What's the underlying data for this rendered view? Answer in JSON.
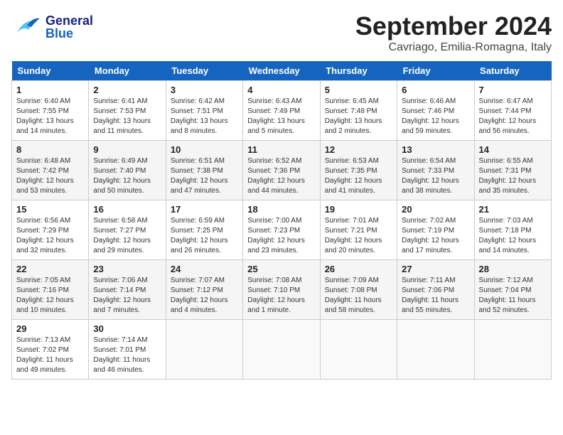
{
  "header": {
    "logo_general": "General",
    "logo_blue": "Blue",
    "month": "September 2024",
    "location": "Cavriago, Emilia-Romagna, Italy"
  },
  "weekdays": [
    "Sunday",
    "Monday",
    "Tuesday",
    "Wednesday",
    "Thursday",
    "Friday",
    "Saturday"
  ],
  "weeks": [
    [
      {
        "day": "1",
        "info": "Sunrise: 6:40 AM\nSunset: 7:55 PM\nDaylight: 13 hours\nand 14 minutes."
      },
      {
        "day": "2",
        "info": "Sunrise: 6:41 AM\nSunset: 7:53 PM\nDaylight: 13 hours\nand 11 minutes."
      },
      {
        "day": "3",
        "info": "Sunrise: 6:42 AM\nSunset: 7:51 PM\nDaylight: 13 hours\nand 8 minutes."
      },
      {
        "day": "4",
        "info": "Sunrise: 6:43 AM\nSunset: 7:49 PM\nDaylight: 13 hours\nand 5 minutes."
      },
      {
        "day": "5",
        "info": "Sunrise: 6:45 AM\nSunset: 7:48 PM\nDaylight: 13 hours\nand 2 minutes."
      },
      {
        "day": "6",
        "info": "Sunrise: 6:46 AM\nSunset: 7:46 PM\nDaylight: 12 hours\nand 59 minutes."
      },
      {
        "day": "7",
        "info": "Sunrise: 6:47 AM\nSunset: 7:44 PM\nDaylight: 12 hours\nand 56 minutes."
      }
    ],
    [
      {
        "day": "8",
        "info": "Sunrise: 6:48 AM\nSunset: 7:42 PM\nDaylight: 12 hours\nand 53 minutes."
      },
      {
        "day": "9",
        "info": "Sunrise: 6:49 AM\nSunset: 7:40 PM\nDaylight: 12 hours\nand 50 minutes."
      },
      {
        "day": "10",
        "info": "Sunrise: 6:51 AM\nSunset: 7:38 PM\nDaylight: 12 hours\nand 47 minutes."
      },
      {
        "day": "11",
        "info": "Sunrise: 6:52 AM\nSunset: 7:36 PM\nDaylight: 12 hours\nand 44 minutes."
      },
      {
        "day": "12",
        "info": "Sunrise: 6:53 AM\nSunset: 7:35 PM\nDaylight: 12 hours\nand 41 minutes."
      },
      {
        "day": "13",
        "info": "Sunrise: 6:54 AM\nSunset: 7:33 PM\nDaylight: 12 hours\nand 38 minutes."
      },
      {
        "day": "14",
        "info": "Sunrise: 6:55 AM\nSunset: 7:31 PM\nDaylight: 12 hours\nand 35 minutes."
      }
    ],
    [
      {
        "day": "15",
        "info": "Sunrise: 6:56 AM\nSunset: 7:29 PM\nDaylight: 12 hours\nand 32 minutes."
      },
      {
        "day": "16",
        "info": "Sunrise: 6:58 AM\nSunset: 7:27 PM\nDaylight: 12 hours\nand 29 minutes."
      },
      {
        "day": "17",
        "info": "Sunrise: 6:59 AM\nSunset: 7:25 PM\nDaylight: 12 hours\nand 26 minutes."
      },
      {
        "day": "18",
        "info": "Sunrise: 7:00 AM\nSunset: 7:23 PM\nDaylight: 12 hours\nand 23 minutes."
      },
      {
        "day": "19",
        "info": "Sunrise: 7:01 AM\nSunset: 7:21 PM\nDaylight: 12 hours\nand 20 minutes."
      },
      {
        "day": "20",
        "info": "Sunrise: 7:02 AM\nSunset: 7:19 PM\nDaylight: 12 hours\nand 17 minutes."
      },
      {
        "day": "21",
        "info": "Sunrise: 7:03 AM\nSunset: 7:18 PM\nDaylight: 12 hours\nand 14 minutes."
      }
    ],
    [
      {
        "day": "22",
        "info": "Sunrise: 7:05 AM\nSunset: 7:16 PM\nDaylight: 12 hours\nand 10 minutes."
      },
      {
        "day": "23",
        "info": "Sunrise: 7:06 AM\nSunset: 7:14 PM\nDaylight: 12 hours\nand 7 minutes."
      },
      {
        "day": "24",
        "info": "Sunrise: 7:07 AM\nSunset: 7:12 PM\nDaylight: 12 hours\nand 4 minutes."
      },
      {
        "day": "25",
        "info": "Sunrise: 7:08 AM\nSunset: 7:10 PM\nDaylight: 12 hours\nand 1 minute."
      },
      {
        "day": "26",
        "info": "Sunrise: 7:09 AM\nSunset: 7:08 PM\nDaylight: 11 hours\nand 58 minutes."
      },
      {
        "day": "27",
        "info": "Sunrise: 7:11 AM\nSunset: 7:06 PM\nDaylight: 11 hours\nand 55 minutes."
      },
      {
        "day": "28",
        "info": "Sunrise: 7:12 AM\nSunset: 7:04 PM\nDaylight: 11 hours\nand 52 minutes."
      }
    ],
    [
      {
        "day": "29",
        "info": "Sunrise: 7:13 AM\nSunset: 7:02 PM\nDaylight: 11 hours\nand 49 minutes."
      },
      {
        "day": "30",
        "info": "Sunrise: 7:14 AM\nSunset: 7:01 PM\nDaylight: 11 hours\nand 46 minutes."
      },
      {
        "day": "",
        "info": ""
      },
      {
        "day": "",
        "info": ""
      },
      {
        "day": "",
        "info": ""
      },
      {
        "day": "",
        "info": ""
      },
      {
        "day": "",
        "info": ""
      }
    ]
  ]
}
